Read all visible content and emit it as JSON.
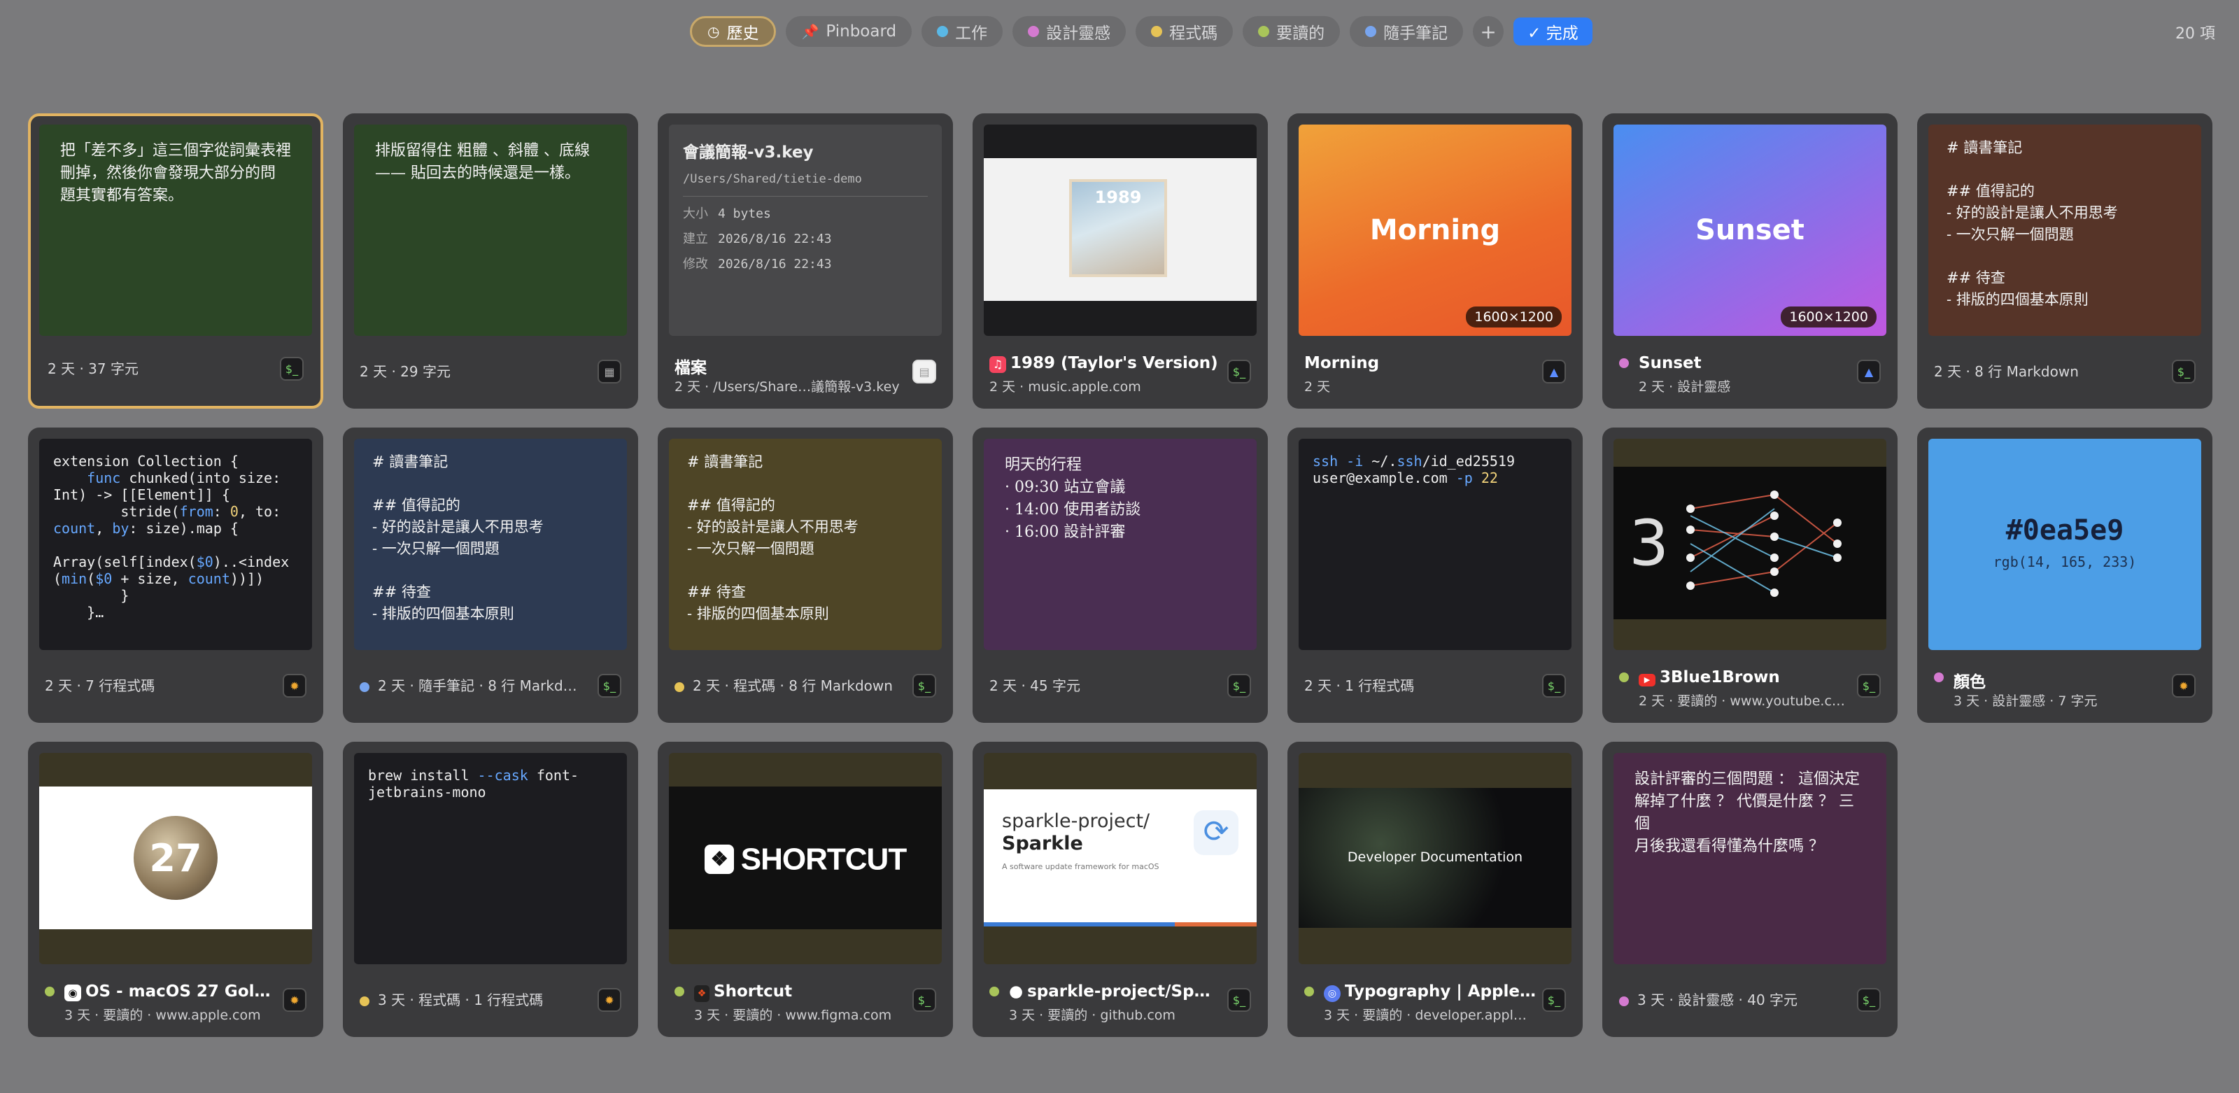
{
  "toolbar": {
    "tabs": [
      {
        "label": "歷史",
        "icon": "clock-icon"
      },
      {
        "label": "Pinboard",
        "icon": "pin-icon"
      },
      {
        "label": "工作",
        "color": "#5ab8e6"
      },
      {
        "label": "設計靈感",
        "color": "#d47ad0"
      },
      {
        "label": "程式碼",
        "color": "#e6c356"
      },
      {
        "label": "要讀的",
        "color": "#a9c55a"
      },
      {
        "label": "隨手筆記",
        "color": "#78a5ef"
      }
    ],
    "add_label": "+",
    "done_label": "✓ 完成",
    "count": "20 項"
  },
  "cards": {
    "c1": {
      "text": "把「差不多」這三個字從詞彙表裡\n刪掉，然後你會發現大部分的問\n題其實都有答案。",
      "meta": "2 天 · 37 字元"
    },
    "c2": {
      "text": "排版留得住 粗體 、斜體 、底線\n—— 貼回去的時候還是一樣。",
      "meta": "2 天 · 29 字元"
    },
    "c3": {
      "filename": "會議簡報-v3.key",
      "path": "/Users/Shared/tietie-demo",
      "size_label": "大小",
      "size": "4 bytes",
      "created_label": "建立",
      "created": "2026/8/16 22:43",
      "modified_label": "修改",
      "modified": "2026/8/16 22:43",
      "title": "檔案",
      "sub": "2 天 · /Users/Share…議簡報-v3.key"
    },
    "c4": {
      "title": "1989 (Taylor's Version)",
      "sub": "2 天 · music.apple.com",
      "album": "1989"
    },
    "c5": {
      "center": "Morning",
      "badge": "1600×1200",
      "title": "Morning",
      "sub": "2 天"
    },
    "c6": {
      "center": "Sunset",
      "badge": "1600×1200",
      "title": "Sunset",
      "sub": "2 天 · 設計靈感"
    },
    "c7": {
      "text": "# 讀書筆記\n\n## 值得記的\n- 好的設計是讓人不用思考\n- 一次只解一個問題\n\n## 待查\n- 排版的四個基本原則",
      "meta": "2 天 · 8 行 Markdown"
    },
    "c8": {
      "meta": "2 天 · 7 行程式碼"
    },
    "c9": {
      "text": "# 讀書筆記\n\n## 值得記的\n- 好的設計是讓人不用思考\n- 一次只解一個問題\n\n## 待查\n- 排版的四個基本原則",
      "meta": "2 天 · 隨手筆記 · 8 行 Markd…"
    },
    "c10": {
      "text": "# 讀書筆記\n\n## 值得記的\n- 好的設計是讓人不用思考\n- 一次只解一個問題\n\n## 待查\n- 排版的四個基本原則",
      "meta": "2 天 · 程式碼 · 8 行 Markdown"
    },
    "c11": {
      "text": "明天的行程\n· 09:30 站立會議\n· 14:00 使用者訪談\n· 16:00 設計評審",
      "meta": "2 天 · 45 字元"
    },
    "c12": {
      "meta": "2 天 · 1 行程式碼"
    },
    "c13": {
      "title": "3Blue1Brown",
      "sub": "2 天 · 要讀的 · www.youtube.c…"
    },
    "c14": {
      "hex": "#0ea5e9",
      "rgb": "rgb(14, 165, 233)",
      "title": "顏色",
      "sub": "3 天 · 設計靈感 · 7 字元"
    },
    "c15": {
      "title": "OS - macOS 27 Gol…",
      "sub": "3 天 · 要讀的 · www.apple.com",
      "big": "27"
    },
    "c16": {
      "meta": "3 天 · 程式碼 · 1 行程式碼"
    },
    "c17": {
      "title": "Shortcut",
      "sub": "3 天 · 要讀的 · www.figma.com",
      "logo": "SHORTCUT"
    },
    "c18": {
      "title": "sparkle-project/Sp…",
      "sub": "3 天 · 要讀的 · github.com",
      "repo1": "sparkle-project/",
      "repo2": "Sparkle",
      "desc": "A software update framework for macOS"
    },
    "c19": {
      "title": "Typography | Apple…",
      "sub": "3 天 · 要讀的 · developer.appl…",
      "doc": " Developer Documentation"
    },
    "c20": {
      "text": "設計評審的三個問題 ： 這個決定\n解掉了什麼 ？ 代價是什麼 ？ 三個\n月後我還看得懂為什麼嗎 ？",
      "meta": "3 天 · 設計靈感 · 40 字元"
    }
  }
}
